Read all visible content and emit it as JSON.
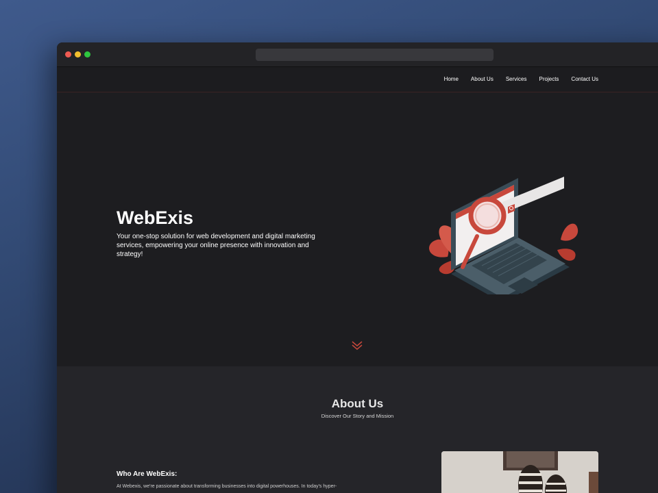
{
  "nav": {
    "items": [
      "Home",
      "About Us",
      "Services",
      "Projects",
      "Contact Us"
    ]
  },
  "hero": {
    "title": "WebExis",
    "subtitle": "Your one-stop solution for web development and digital marketing services, empowering your online presence with innovation and strategy!"
  },
  "about": {
    "title": "About Us",
    "subtitle": "Discover Our Story and Mission",
    "who_title": "Who Are WebExis:",
    "who_text": "At Webexis, we're passionate about transforming businesses into digital powerhouses. In today's hyper-"
  },
  "colors": {
    "accent": "#c8483c",
    "background": "#1d1d20",
    "section_bg": "#252529"
  },
  "icons": {
    "hero_illustration": "laptop-magnifier-illustration",
    "scroll": "double-chevron-down-icon"
  }
}
